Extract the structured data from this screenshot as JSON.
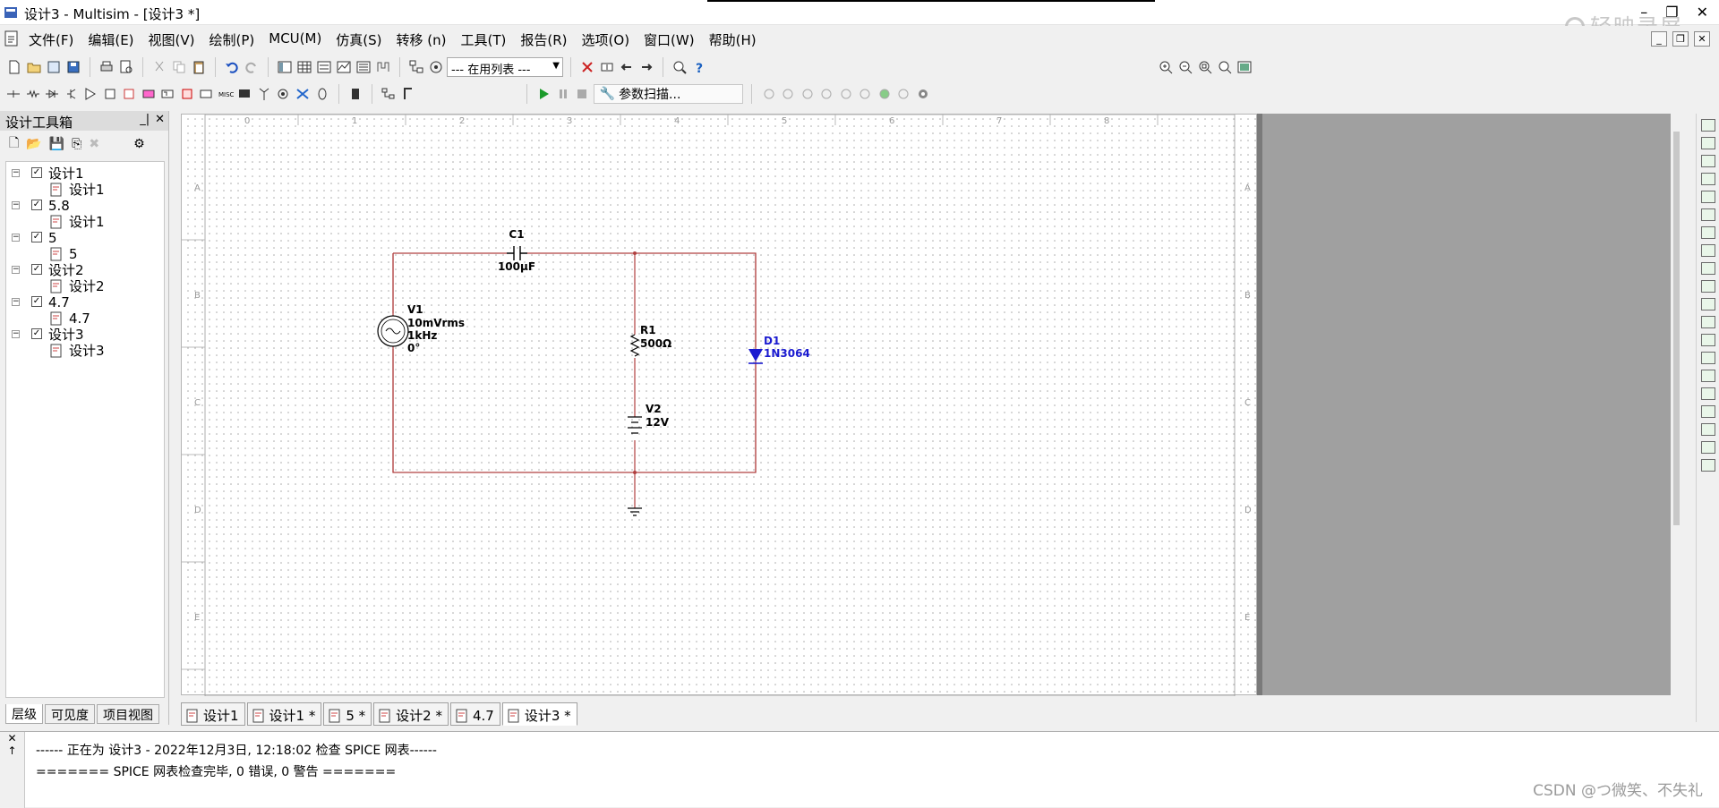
{
  "window": {
    "title": "设计3 - Multisim - [设计3 *]",
    "watermark": "轻映录屏"
  },
  "menu": [
    "文件(F)",
    "编辑(E)",
    "视图(V)",
    "绘制(P)",
    "MCU(M)",
    "仿真(S)",
    "转移 (n)",
    "工具(T)",
    "报告(R)",
    "选项(O)",
    "窗口(W)",
    "帮助(H)"
  ],
  "toolbar": {
    "in_use_list": "--- 在用列表 ---",
    "sim_param_label": "参数扫描..."
  },
  "toolbox": {
    "title": "设计工具箱",
    "tree": [
      {
        "label": "设计1",
        "child": "设计1"
      },
      {
        "label": "5.8",
        "child": "设计1"
      },
      {
        "label": "5",
        "child": "5"
      },
      {
        "label": "设计2",
        "child": "设计2"
      },
      {
        "label": "4.7",
        "child": "4.7"
      },
      {
        "label": "设计3",
        "child": "设计3"
      }
    ],
    "tabs": [
      "层级",
      "可见度",
      "项目视图"
    ]
  },
  "schematic": {
    "ruler_top": [
      "0",
      "1",
      "2",
      "3",
      "4",
      "5",
      "6",
      "7",
      "8"
    ],
    "ruler_side": [
      "A",
      "B",
      "C",
      "D",
      "E"
    ],
    "components": {
      "C1": {
        "name": "C1",
        "value": "100µF"
      },
      "V1": {
        "name": "V1",
        "value": "10mVrms",
        "freq": "1kHz",
        "phase": "0°"
      },
      "R1": {
        "name": "R1",
        "value": "500Ω"
      },
      "D1": {
        "name": "D1",
        "value": "1N3064"
      },
      "V2": {
        "name": "V2",
        "value": "12V"
      }
    },
    "colors": {
      "wire": "#b04040",
      "component": "#000000",
      "diode": "#1a1ad0",
      "grid": "#a8a8a8"
    }
  },
  "doc_tabs": [
    "设计1",
    "设计1 *",
    "5 *",
    "设计2 *",
    "4.7",
    "设计3 *"
  ],
  "output": {
    "line1": "------ 正在为 设计3 - 2022年12月3日, 12:18:02 检查 SPICE 网表------",
    "line2": "======= SPICE 网表检查完毕, 0 错误, 0 警告 ======="
  },
  "csdn_watermark": "CSDN @つ微笑、不失礼"
}
